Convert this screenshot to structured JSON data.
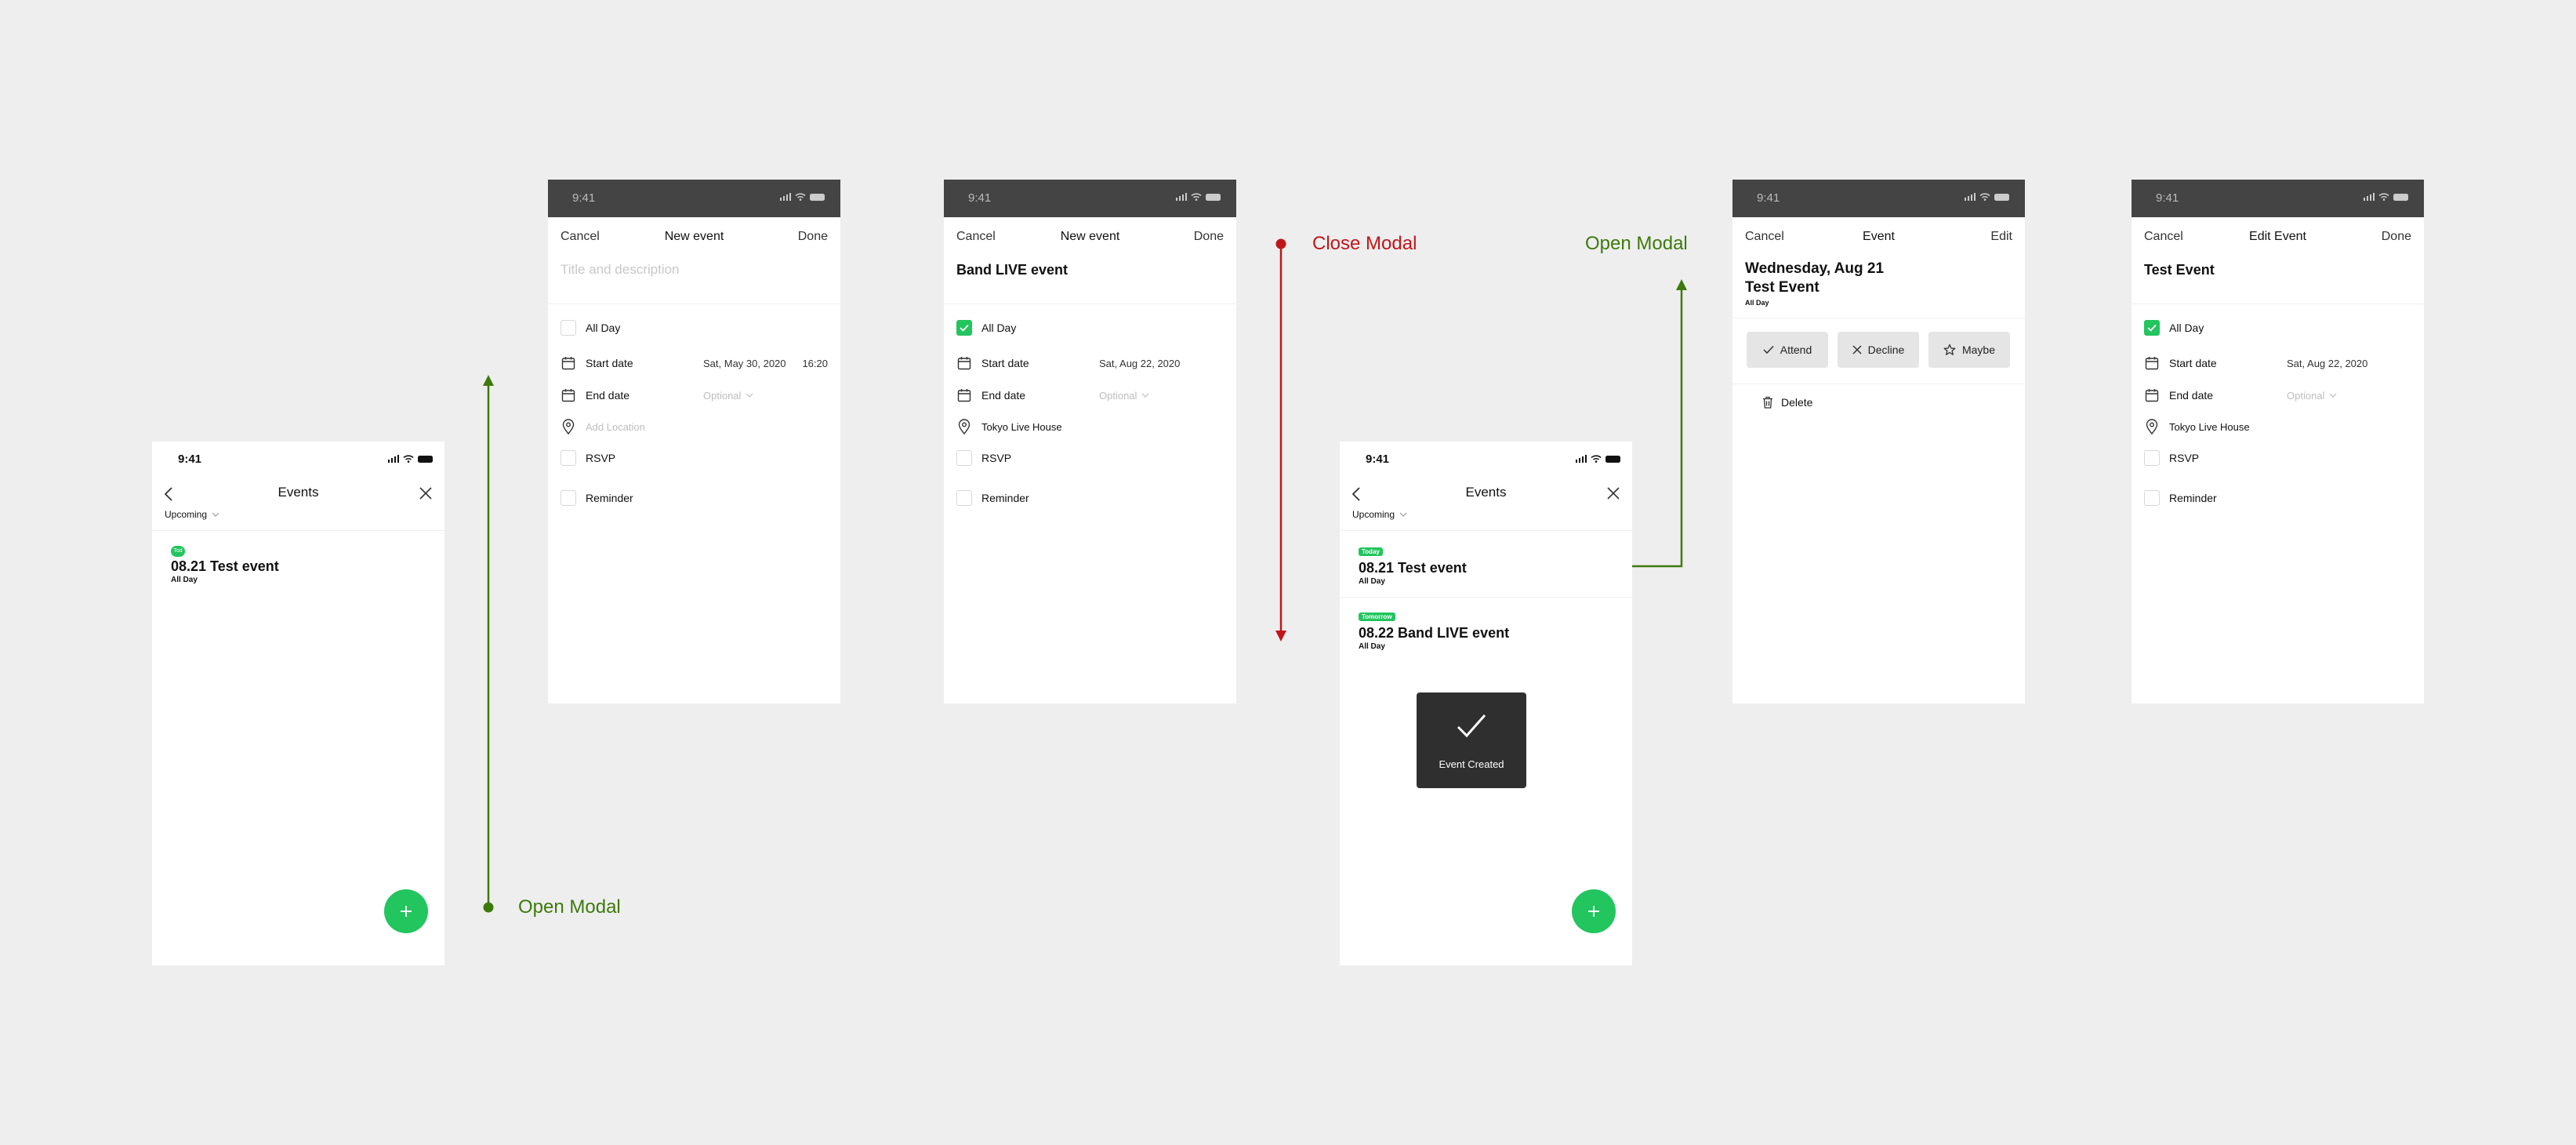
{
  "colors": {
    "accent_green": "#22c55e",
    "flow_green": "#3d7a0c",
    "flow_red": "#c0161a",
    "status_bar_dark": "#444444"
  },
  "flow": {
    "open_modal_1": "Open Modal",
    "close_modal": "Close Modal",
    "open_modal_2": "Open Modal"
  },
  "screens": {
    "events_list": {
      "time": "9:41",
      "title": "Events",
      "filter": "Upcoming",
      "events": [
        {
          "tag": "Tod",
          "title": "08.21 Test event",
          "sub": "All Day"
        }
      ],
      "fab_icon": "plus-icon"
    },
    "new_event_empty": {
      "time": "9:41",
      "cancel": "Cancel",
      "title": "New event",
      "done": "Done",
      "title_placeholder": "Title and description",
      "all_day": "All Day",
      "start_label": "Start date",
      "start_value": "Sat, May 30, 2020",
      "start_time": "16:20",
      "end_label": "End date",
      "end_value": "Optional",
      "location_placeholder": "Add Location",
      "rsvp": "RSVP",
      "reminder": "Reminder"
    },
    "new_event_filled": {
      "time": "9:41",
      "cancel": "Cancel",
      "title": "New event",
      "done": "Done",
      "event_title": "Band LIVE event",
      "all_day": "All Day",
      "start_label": "Start date",
      "start_value": "Sat, Aug 22, 2020",
      "end_label": "End date",
      "end_value": "Optional",
      "location": "Tokyo Live House",
      "rsvp": "RSVP",
      "reminder": "Reminder"
    },
    "events_list_created": {
      "time": "9:41",
      "title": "Events",
      "filter": "Upcoming",
      "events": [
        {
          "tag": "Today",
          "title": "08.21 Test event",
          "sub": "All Day"
        },
        {
          "tag": "Tomorrow",
          "title": "08.22 Band LIVE event",
          "sub": "All Day"
        }
      ],
      "toast": "Event Created"
    },
    "event_detail": {
      "time": "9:41",
      "cancel": "Cancel",
      "title": "Event",
      "edit": "Edit",
      "date_line": "Wednesday, Aug 21",
      "event_title": "Test Event",
      "all_day": "All Day",
      "attend": "Attend",
      "decline": "Decline",
      "maybe": "Maybe",
      "delete": "Delete"
    },
    "edit_event": {
      "time": "9:41",
      "cancel": "Cancel",
      "title": "Edit Event",
      "done": "Done",
      "event_title": "Test Event",
      "all_day": "All Day",
      "start_label": "Start date",
      "start_value": "Sat, Aug 22, 2020",
      "end_label": "End date",
      "end_value": "Optional",
      "location": "Tokyo Live House",
      "rsvp": "RSVP",
      "reminder": "Reminder"
    }
  }
}
